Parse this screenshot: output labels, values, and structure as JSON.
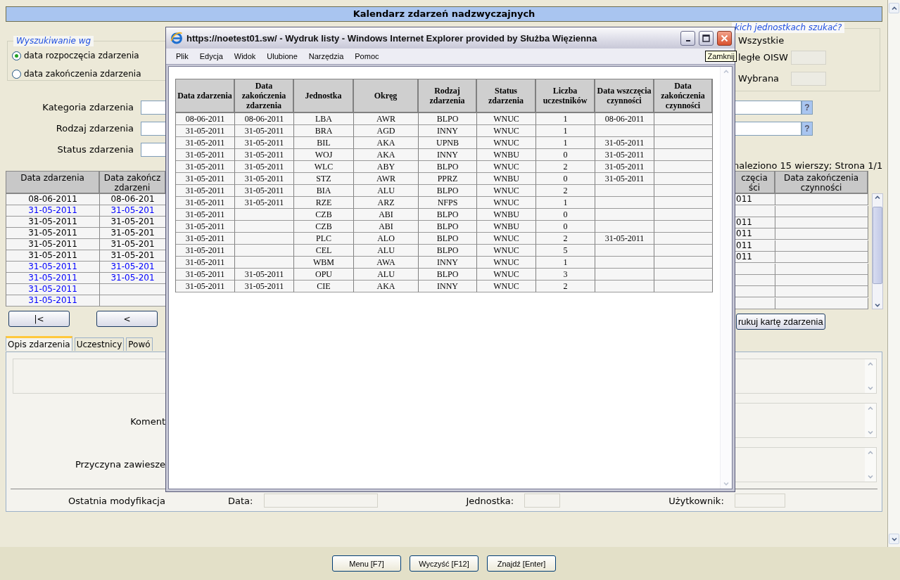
{
  "page": {
    "title": "Kalendarz zdarzeń nadzwyczajnych"
  },
  "search_by": {
    "legend": "Wyszukiwanie wg",
    "options": [
      {
        "label": "data rozpoczęcia zdarzenia",
        "selected": true
      },
      {
        "label": "data zakończenia zdarzenia",
        "selected": false
      }
    ]
  },
  "units": {
    "legend": "kich jednostkach szukać?",
    "options": [
      {
        "label": "Wszystkie",
        "kind": "plain"
      },
      {
        "label": "ległe OISW",
        "kind": "field"
      },
      {
        "label": "Wybrana",
        "kind": "field"
      }
    ]
  },
  "filters": [
    {
      "label": "Kategoria zdarzenia",
      "help": "?"
    },
    {
      "label": "Rodzaj zdarzenia",
      "help": "?"
    },
    {
      "label": "Status zdarzenia"
    }
  ],
  "results": {
    "summary": "naleziono 15 wierszy; Strona 1/1",
    "left_columns": [
      "Data zdarzenia",
      "Data zakończ zdarzeni"
    ],
    "right_columns": [
      "częcia ści",
      "Data zakończenia czynności"
    ],
    "rows": [
      {
        "color": "#000000",
        "event_date": "08-06-2011",
        "end_date": "08-06-201",
        "activity_start": "011"
      },
      {
        "color": "#0000ff",
        "event_date": "31-05-2011",
        "end_date": "31-05-201"
      },
      {
        "color": "#000000",
        "event_date": "31-05-2011",
        "end_date": "31-05-201",
        "activity_start": "011"
      },
      {
        "color": "#000000",
        "event_date": "31-05-2011",
        "end_date": "31-05-201",
        "activity_start": "011"
      },
      {
        "color": "#000000",
        "event_date": "31-05-2011",
        "end_date": "31-05-201",
        "activity_start": "011"
      },
      {
        "color": "#000000",
        "event_date": "31-05-2011",
        "end_date": "31-05-201",
        "activity_start": "011"
      },
      {
        "color": "#0000ff",
        "event_date": "31-05-2011",
        "end_date": "31-05-201"
      },
      {
        "color": "#0000ff",
        "event_date": "31-05-2011",
        "end_date": "31-05-201"
      },
      {
        "color": "#0000ff",
        "event_date": "31-05-2011"
      },
      {
        "color": "#0000ff",
        "event_date": "31-05-2011"
      }
    ]
  },
  "nav_buttons": [
    "|<",
    "<"
  ],
  "print_button": "rukuj kartę zdarzenia",
  "tabs": [
    {
      "label": "Opis zdarzenia",
      "selected": true
    },
    {
      "label": "Uczestnicy",
      "selected": false
    },
    {
      "label": "Powó",
      "selected": false
    }
  ],
  "description_labels": [
    "Koment",
    "Przyczyna zawiesze"
  ],
  "last_modified": {
    "label": "Ostatnia modyfikacja",
    "fields": [
      "Data:",
      "Jednostka:",
      "Użytkownik:"
    ]
  },
  "footer_buttons": [
    "Menu [F7]",
    "Wyczyść [F12]",
    "Znajdź [Enter]"
  ],
  "popup": {
    "title": "https://noetest01.sw/ - Wydruk listy - Windows Internet Explorer provided by Służba Więzienna",
    "tooltip": "Zamknij",
    "menu": [
      "Plik",
      "Edycja",
      "Widok",
      "Ulubione",
      "Narzędzia",
      "Pomoc"
    ],
    "columns": [
      "Data zdarzenia",
      "Data zakończenia zdarzenia",
      "Jednostka",
      "Okręg",
      "Rodzaj zdarzenia",
      "Status zdarzenia",
      "Liczba uczestników",
      "Data wszczęcia czynności",
      "Data zakończenia czynności"
    ],
    "rows": [
      {
        "event_date": "08-06-2011",
        "end_date": "08-06-2011",
        "unit": "LBA",
        "district": "AWR",
        "type": "BLPO",
        "status": "WNUC",
        "participants": "1",
        "activity_start": "08-06-2011"
      },
      {
        "event_date": "31-05-2011",
        "end_date": "31-05-2011",
        "unit": "BRA",
        "district": "AGD",
        "type": "INNY",
        "status": "WNUC",
        "participants": "1"
      },
      {
        "event_date": "31-05-2011",
        "end_date": "31-05-2011",
        "unit": "BIL",
        "district": "AKA",
        "type": "UPNB",
        "status": "WNUC",
        "participants": "1",
        "activity_start": "31-05-2011"
      },
      {
        "event_date": "31-05-2011",
        "end_date": "31-05-2011",
        "unit": "WOJ",
        "district": "AKA",
        "type": "INNY",
        "status": "WNBU",
        "participants": "0",
        "activity_start": "31-05-2011"
      },
      {
        "event_date": "31-05-2011",
        "end_date": "31-05-2011",
        "unit": "WLC",
        "district": "ABY",
        "type": "BLPO",
        "status": "WNUC",
        "participants": "2",
        "activity_start": "31-05-2011"
      },
      {
        "event_date": "31-05-2011",
        "end_date": "31-05-2011",
        "unit": "STZ",
        "district": "AWR",
        "type": "PPRZ",
        "status": "WNBU",
        "participants": "0",
        "activity_start": "31-05-2011"
      },
      {
        "event_date": "31-05-2011",
        "end_date": "31-05-2011",
        "unit": "BIA",
        "district": "ALU",
        "type": "BLPO",
        "status": "WNUC",
        "participants": "2"
      },
      {
        "event_date": "31-05-2011",
        "end_date": "31-05-2011",
        "unit": "RZE",
        "district": "ARZ",
        "type": "NFPS",
        "status": "WNUC",
        "participants": "1"
      },
      {
        "event_date": "31-05-2011",
        "unit": "CZB",
        "district": "ABI",
        "type": "BLPO",
        "status": "WNBU",
        "participants": "0"
      },
      {
        "event_date": "31-05-2011",
        "unit": "CZB",
        "district": "ABI",
        "type": "BLPO",
        "status": "WNBU",
        "participants": "0"
      },
      {
        "event_date": "31-05-2011",
        "unit": "PLC",
        "district": "ALO",
        "type": "BLPO",
        "status": "WNUC",
        "participants": "2",
        "activity_start": "31-05-2011"
      },
      {
        "event_date": "31-05-2011",
        "unit": "CEL",
        "district": "ALU",
        "type": "BLPO",
        "status": "WNUC",
        "participants": "5"
      },
      {
        "event_date": "31-05-2011",
        "unit": "WBM",
        "district": "AWA",
        "type": "INNY",
        "status": "WNUC",
        "participants": "1"
      },
      {
        "event_date": "31-05-2011",
        "end_date": "31-05-2011",
        "unit": "OPU",
        "district": "ALU",
        "type": "BLPO",
        "status": "WNUC",
        "participants": "3"
      },
      {
        "event_date": "31-05-2011",
        "end_date": "31-05-2011",
        "unit": "CIE",
        "district": "AKA",
        "type": "INNY",
        "status": "WNUC",
        "participants": "2"
      }
    ]
  }
}
